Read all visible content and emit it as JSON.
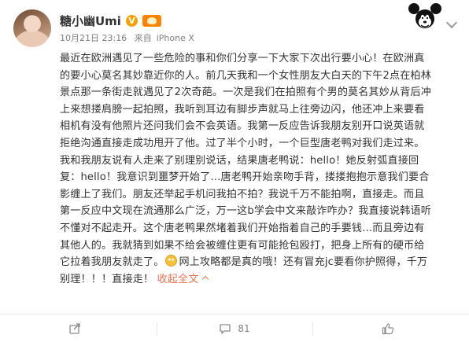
{
  "post": {
    "author_name": "糖小幽Umi",
    "verified_icon": "v-badge-icon",
    "level_icon": "member-badge-icon",
    "timestamp": "10月21日 23:16",
    "source_prefix": "来自",
    "source_device": "iPhone X",
    "text_lines": [
      "最近在欧洲遇见了一些危险的事和你们分享一下大家下次出行要小心！在欧洲真",
      "的要小心莫名其妙靠近你的人。前几天我和一个女性朋友大白天的下午2点在柏林",
      "景点那一条街走就遇见了2次奇葩。一次是我们在拍照有个男的莫名其妙从背后冲",
      "上来想搂肩膀一起拍照，我听到耳边有脚步声就马上往旁边闪，他还冲上来要看",
      "相机有没有他照片还问我们会不会英语。我第一反应告诉我朋友别开口说英语就",
      "拒绝沟通直接走成功甩开了他。过了半个小时，一个巨型唐老鸭对我们走过来。",
      "我和我朋友说有人走来了别理别说话，结果唐老鸭说：hello！她反射弧直接回",
      "复：hello！我意识到噩梦开始了…唐老鸭开始亲吻手背，搂搂抱抱示意我们要合",
      "影缠上了我们。朋友还举起手机问我拍不拍？我说千万不能拍啊，直接走。而且",
      "第一反应中文现在流通那么广泛，万一这b学会中文来敲诈咋办？我直接说韩语听",
      "不懂对不起走开。这个唐老鸭果然堵着我们开始指着自己的手要钱…而且旁边有",
      "其他人的。我就猜到如果不给会被缠住更有可能抢包殴打，把身上所有的硬币给",
      "它拉着我朋友就走了。"
    ],
    "last_line_after_emoji": "网上攻略都是真的哦！还有冒充jc要看你护照得，千万",
    "final_line": "别理！！！直接走！",
    "emoji_icon": "laughing-emoji-icon",
    "collapse_label": "收起全文",
    "collapse_icon": "chevron-up-icon",
    "more_icon": "chevron-down-icon",
    "sticker_icon": "mickey-sticker-icon"
  },
  "actions": {
    "share_icon": "share-icon",
    "share_label": "",
    "comment_icon": "comment-icon",
    "comment_count": "81",
    "like_icon": "like-icon",
    "like_count": "",
    "extra_icon": "more-dots-icon"
  }
}
